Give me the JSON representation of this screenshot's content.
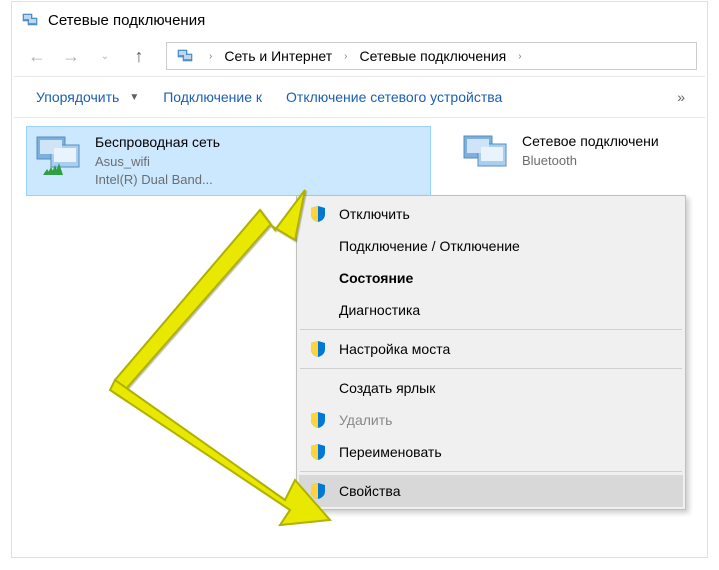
{
  "title": "Сетевые подключения",
  "breadcrumb": {
    "items": [
      "Сеть и Интернет",
      "Сетевые подключения"
    ]
  },
  "toolbar": {
    "organize": "Упорядочить",
    "connect": "Подключение к",
    "disable": "Отключение сетевого устройства",
    "overflow": "»"
  },
  "adapters": {
    "wifi": {
      "name": "Беспроводная сеть",
      "status": "Asus_wifi",
      "device": "Intel(R) Dual Band..."
    },
    "bluetooth": {
      "name": "Сетевое подключени",
      "status": "Bluetooth"
    }
  },
  "context_menu": {
    "disable": "Отключить",
    "connect_disconnect": "Подключение / Отключение",
    "status": "Состояние",
    "diagnose": "Диагностика",
    "bridge": "Настройка моста",
    "shortcut": "Создать ярлык",
    "delete": "Удалить",
    "rename": "Переименовать",
    "properties": "Свойства"
  }
}
